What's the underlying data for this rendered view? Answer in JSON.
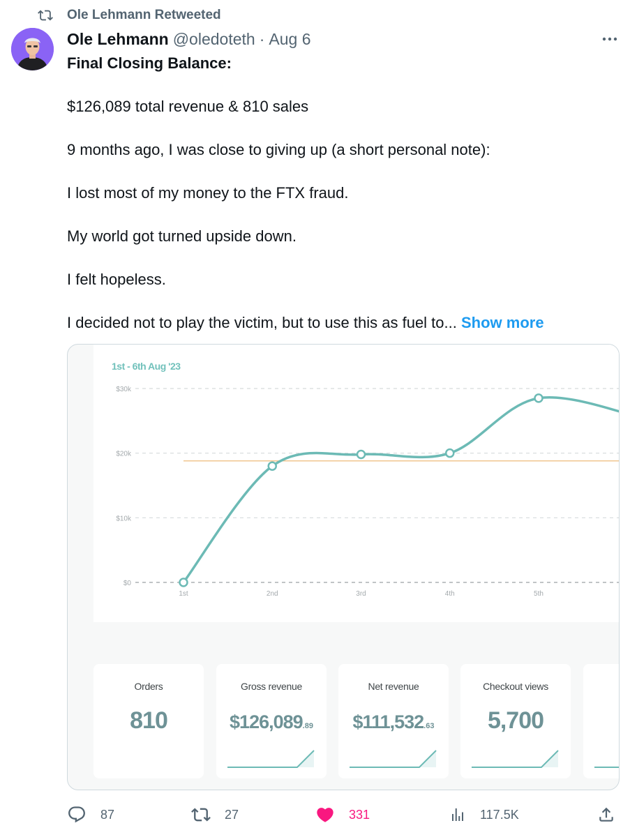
{
  "retweet": {
    "text": "Ole Lehmann Retweeted",
    "icon": "retweet-icon"
  },
  "author": {
    "name": "Ole Lehmann",
    "handle": "@oledoteth",
    "separator": "·",
    "date": "Aug 6"
  },
  "tweet": {
    "lines": [
      "Final Closing Balance:",
      "$126,089 total revenue & 810 sales",
      "9 months ago, I was close to giving up (a short personal note):",
      "I lost most of my money to the FTX fraud.",
      "My world got turned upside down.",
      "I felt hopeless.",
      "I decided not to play the victim, but to use this as fuel to..."
    ],
    "show_more": "Show more"
  },
  "media": {
    "stats": [
      {
        "label": "Orders",
        "value": "810",
        "cents": ""
      },
      {
        "label": "Gross revenue",
        "value": "$126,089",
        "cents": ".89"
      },
      {
        "label": "Net revenue",
        "value": "$111,532",
        "cents": ".63"
      },
      {
        "label": "Checkout views",
        "value": "5,700",
        "cents": ""
      }
    ]
  },
  "chart_data": {
    "type": "line",
    "title": "1st - 6th Aug '23",
    "categories": [
      "1st",
      "2nd",
      "3rd",
      "4th",
      "5th"
    ],
    "series": [
      {
        "values": [
          0,
          18000,
          19800,
          20000,
          28500
        ],
        "color": "#6cbab5"
      }
    ],
    "reference_line": {
      "value": 18800,
      "color": "#f0c58f"
    },
    "y_ticks": [
      "$0",
      "$10k",
      "$20k",
      "$30k"
    ],
    "ylim": [
      0,
      30000
    ],
    "grid": true
  },
  "actions": {
    "replies": "87",
    "retweets": "27",
    "likes": "331",
    "views": "117.5K"
  },
  "colors": {
    "accent": "#1d9bf0",
    "like": "#f91880",
    "muted": "#536471",
    "line": "#6cbab5",
    "reference": "#f0c58f"
  }
}
